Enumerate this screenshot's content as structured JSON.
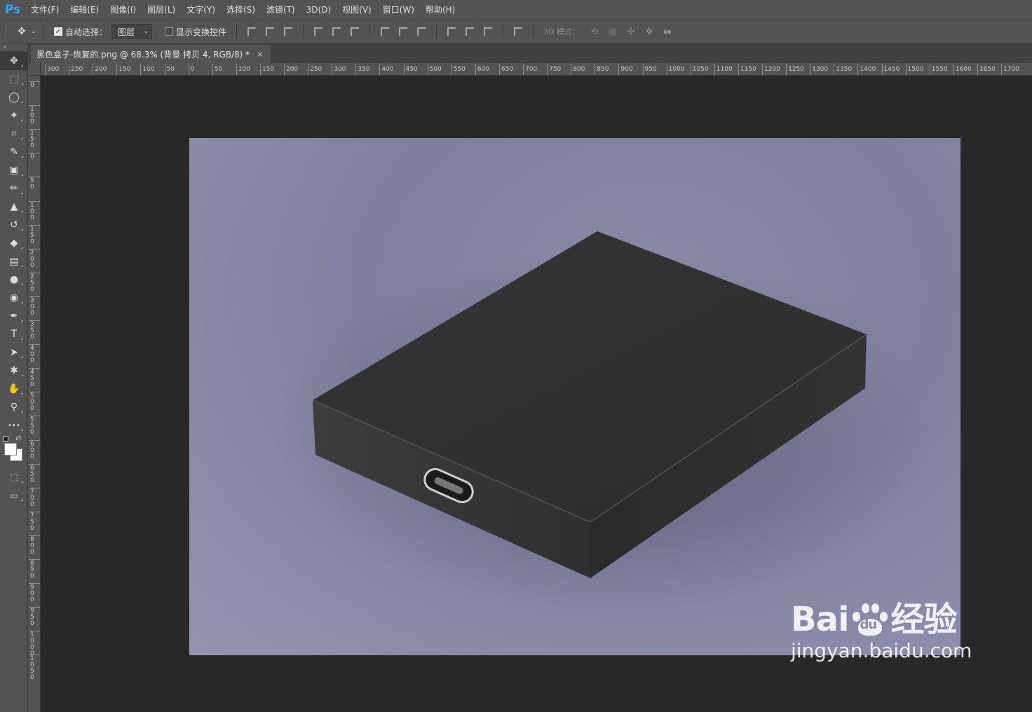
{
  "app": {
    "logo": "Ps"
  },
  "menu": [
    "文件(F)",
    "编辑(E)",
    "图像(I)",
    "图层(L)",
    "文字(Y)",
    "选择(S)",
    "滤镜(T)",
    "3D(D)",
    "视图(V)",
    "窗口(W)",
    "帮助(H)"
  ],
  "options": {
    "auto_select_label": "自动选择：",
    "auto_select_checked": true,
    "auto_select_value": "图层",
    "show_transform_label": "显示变换控件",
    "show_transform_checked": false,
    "mode_3d_label": "3D 模式："
  },
  "document_tab": {
    "title": "黑色盒子-恢复的.png @ 68.3% (背景 拷贝 4, RGB/8) *",
    "close": "×"
  },
  "ruler_h_labels": [
    "300",
    "250",
    "200",
    "150",
    "100",
    "50",
    "0",
    "50",
    "100",
    "150",
    "200",
    "250",
    "300",
    "350",
    "400",
    "450",
    "500",
    "550",
    "600",
    "650",
    "700",
    "750",
    "800",
    "850",
    "900",
    "950",
    "1000",
    "1050",
    "1100",
    "1150",
    "1200",
    "1250",
    "1300",
    "1350",
    "1400",
    "1450",
    "1500",
    "1550",
    "1600",
    "1650",
    "1700"
  ],
  "ruler_v_labels": [
    "0",
    "100",
    "150",
    "0",
    "50",
    "100",
    "150",
    "200",
    "250",
    "300",
    "350",
    "400",
    "450",
    "500",
    "550",
    "600",
    "650",
    "700",
    "750",
    "800",
    "850",
    "900",
    "950",
    "1000",
    "1050"
  ],
  "tools": [
    {
      "name": "move-tool",
      "glyph": "✥",
      "active": true
    },
    {
      "name": "marquee-tool",
      "glyph": "⬚"
    },
    {
      "name": "lasso-tool",
      "glyph": "◯"
    },
    {
      "name": "magic-wand-tool",
      "glyph": "✦"
    },
    {
      "name": "crop-tool",
      "glyph": "⌗"
    },
    {
      "name": "eyedropper-tool",
      "glyph": "✎"
    },
    {
      "name": "frame-tool",
      "glyph": "▣"
    },
    {
      "name": "brush-tool",
      "glyph": "✏"
    },
    {
      "name": "stamp-tool",
      "glyph": "▲"
    },
    {
      "name": "history-brush-tool",
      "glyph": "↺"
    },
    {
      "name": "eraser-tool",
      "glyph": "◆"
    },
    {
      "name": "gradient-tool",
      "glyph": "▤"
    },
    {
      "name": "blur-tool",
      "glyph": "●"
    },
    {
      "name": "dodge-tool",
      "glyph": "◉"
    },
    {
      "name": "pen-tool",
      "glyph": "✒"
    },
    {
      "name": "type-tool",
      "glyph": "T"
    },
    {
      "name": "path-select-tool",
      "glyph": "➤"
    },
    {
      "name": "shape-tool",
      "glyph": "✱"
    },
    {
      "name": "hand-tool",
      "glyph": "✋"
    },
    {
      "name": "zoom-tool",
      "glyph": "⚲"
    },
    {
      "name": "more-tools",
      "glyph": "•••"
    }
  ],
  "colors": {
    "foreground": "#ffffff",
    "background": "#ffffff",
    "canvas_bg": "#8a8aa6",
    "accent": "#31a8ff"
  },
  "watermark": {
    "brand_left": "Bai",
    "brand_mid": "du",
    "brand_right": "经验",
    "url": "jingyan.baidu.com"
  }
}
